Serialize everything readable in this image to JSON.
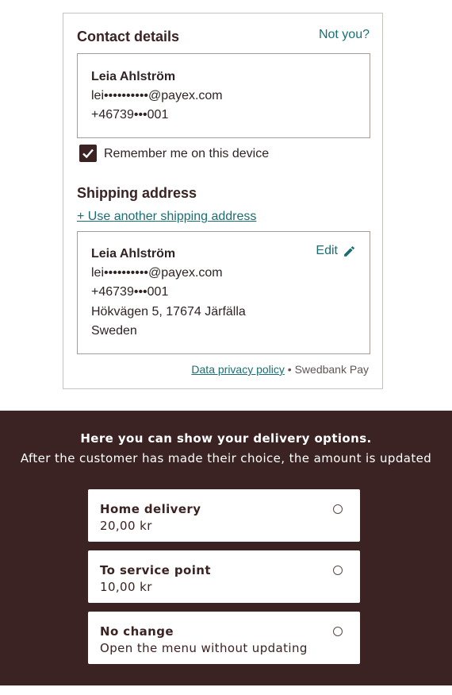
{
  "contact": {
    "title": "Contact details",
    "not_you": "Not you?",
    "name": "Leia Ahlström",
    "email": "lei••••••••••@payex.com",
    "phone": "+46739•••001",
    "remember_label": "Remember me on this device",
    "remember_checked": true
  },
  "shipping": {
    "title": "Shipping address",
    "use_another": "+ Use another shipping address",
    "edit": "Edit",
    "name": "Leia Ahlström",
    "email": "lei••••••••••@payex.com",
    "phone": "+46739•••001",
    "address": "Hökvägen 5, 17674 Järfälla",
    "country": "Sweden"
  },
  "footer": {
    "privacy": "Data privacy policy",
    "separator": "•",
    "brand": "Swedbank Pay"
  },
  "delivery": {
    "heading": "Here you can show your delivery options.",
    "subheading": "After the customer has made their choice, the amount is updated",
    "options": [
      {
        "name": "Home delivery",
        "value": "20,00 kr"
      },
      {
        "name": "To service point",
        "value": "10,00 kr"
      },
      {
        "name": "No change",
        "value": "Open the menu without updating"
      }
    ]
  },
  "colors": {
    "brand_dark": "#3a2322",
    "link": "#1a6e73"
  },
  "icons": {
    "checkbox": "check-icon",
    "edit": "pencil-icon",
    "radio": "radio-empty-icon"
  }
}
